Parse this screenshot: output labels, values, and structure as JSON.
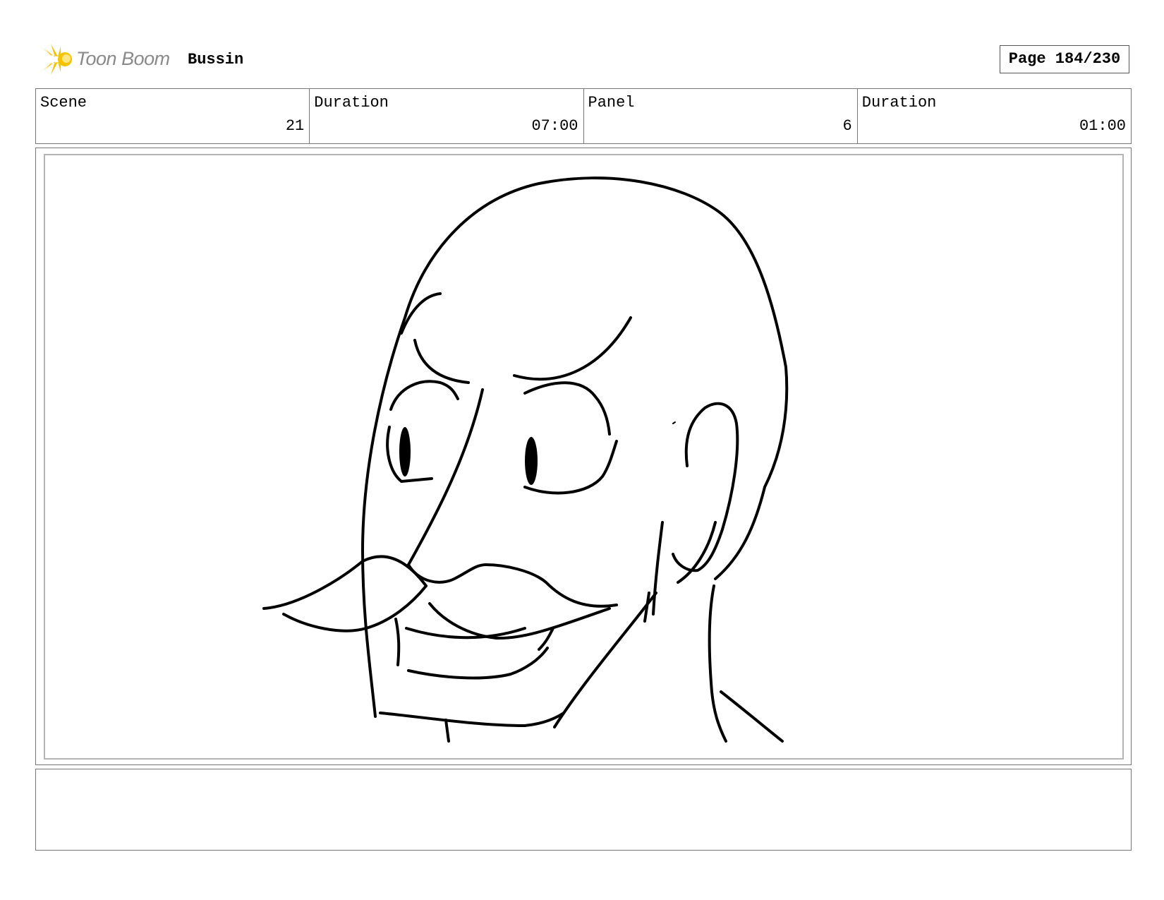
{
  "header": {
    "logo_text": "Toon Boom",
    "logo_icon": "starburst-logo-icon",
    "project_title": "Bussin",
    "page_label": "Page 184/230"
  },
  "info": {
    "scene_label": "Scene",
    "scene_value": "21",
    "scene_duration_label": "Duration",
    "scene_duration_value": "07:00",
    "panel_label": "Panel",
    "panel_value": "6",
    "panel_duration_label": "Duration",
    "panel_duration_value": "01:00"
  },
  "panel": {
    "drawing": "storyboard-sketch"
  },
  "notes": {
    "text": ""
  },
  "colors": {
    "logo_accent": "#f5c400",
    "logo_text": "#8a8a8a",
    "border": "#777777",
    "inner_border": "#b5b5b5"
  }
}
